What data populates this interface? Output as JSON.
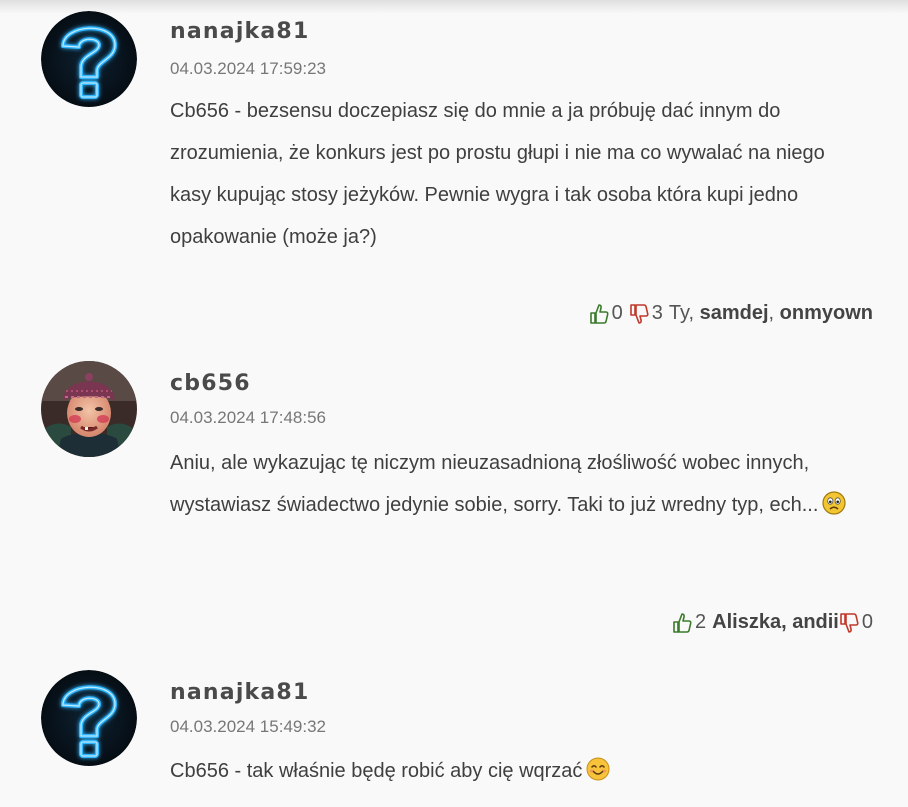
{
  "comments": [
    {
      "author": "nanajka81",
      "date": "04.03.2024 17:59:23",
      "text": "Cb656 - bezsensu doczepiasz się do mnie a ja próbuję dać innym do zrozumienia, że konkurs jest po prostu głupi i nie ma co wywalać na niego kasy kupując stosy jeżyków. Pewnie wygra i tak osoba która kupi jedno opakowanie (może ja?)",
      "upvotes": "0",
      "downvotes": "3",
      "down_voters_prefix": "Ty, ",
      "down_voters_a": "samdej",
      "down_voters_sep": ", ",
      "down_voters_b": "onmyown",
      "avatar_icon": "question-mark-neon-icon"
    },
    {
      "author": "cb656",
      "date": "04.03.2024 17:48:56",
      "text": "Aniu, ale wykazując tę niczym nieuzasadnioną złośliwość wobec innych, wystawiasz świadectwo jedynie sobie, sorry. Taki to już wredny typ, ech...",
      "emoji_icon": "worried-face-icon",
      "upvotes": "2",
      "up_voters": "Aliszka, andii",
      "downvotes": "0",
      "avatar_icon": "user-photo-avatar"
    },
    {
      "author": "nanajka81",
      "date": "04.03.2024 15:49:32",
      "text": "Cb656 - tak właśnie będę robić aby cię wqrzać",
      "emoji_icon": "smiling-face-icon",
      "avatar_icon": "question-mark-neon-icon"
    }
  ],
  "colors": {
    "upvote": "#3a7a2a",
    "downvote": "#c0392b",
    "author": "#4a4a4a",
    "date": "#777777",
    "background": "#f9f9f9"
  }
}
